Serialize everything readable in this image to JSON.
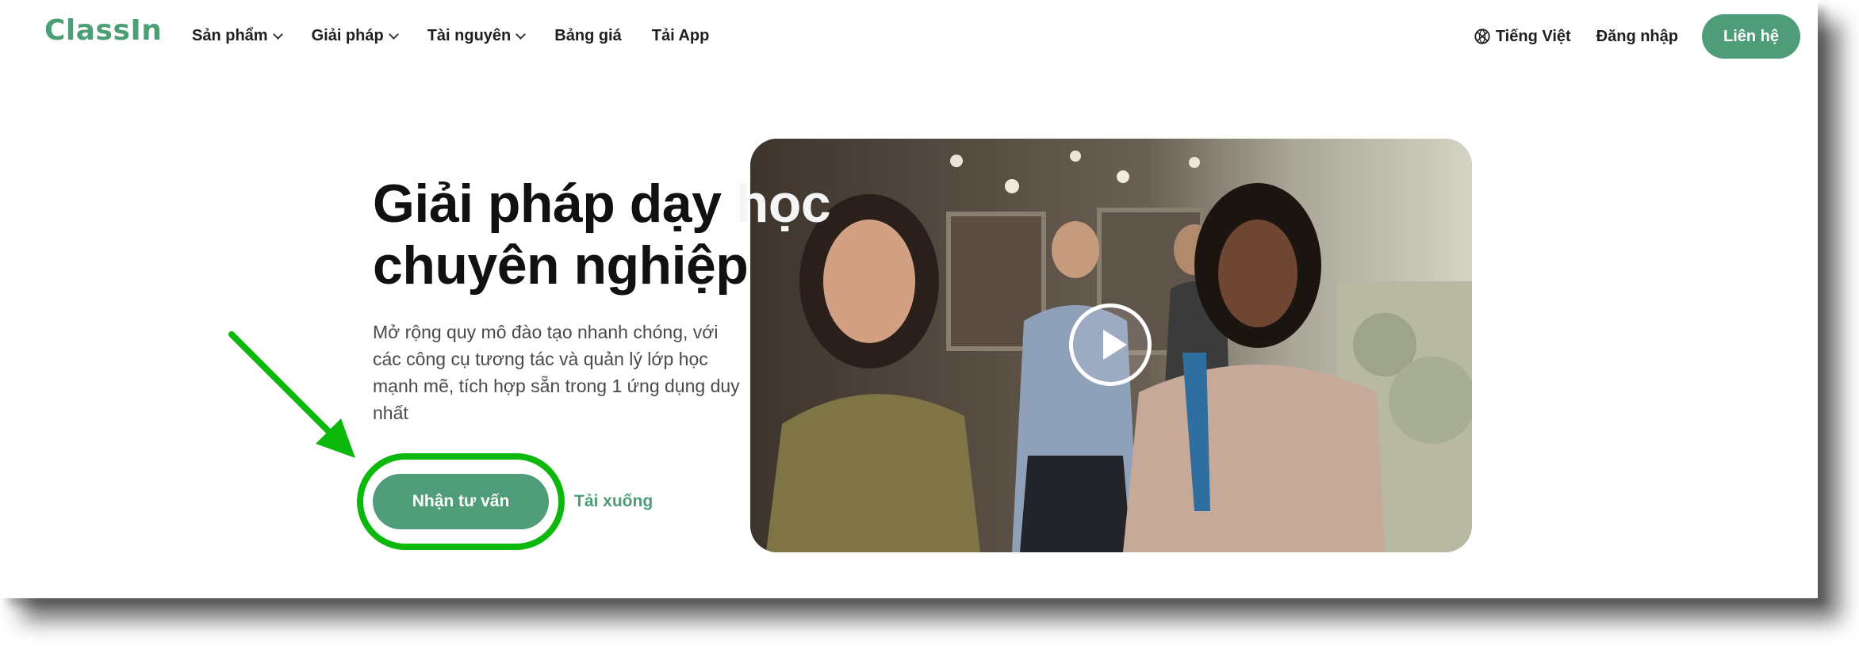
{
  "brand": {
    "logo_text": "ClassIn",
    "accent_color": "#4e9c78"
  },
  "nav": {
    "menu": [
      {
        "label": "Sản phẩm",
        "has_dropdown": true
      },
      {
        "label": "Giải pháp",
        "has_dropdown": true
      },
      {
        "label": "Tài nguyên",
        "has_dropdown": true
      },
      {
        "label": "Bảng giá",
        "has_dropdown": false
      },
      {
        "label": "Tải App",
        "has_dropdown": false
      }
    ],
    "language": {
      "label": "Tiếng Việt",
      "icon": "globe-icon"
    },
    "login_label": "Đăng nhập",
    "contact_label": "Liên hệ"
  },
  "hero": {
    "title_line1_dark": "Giải pháp dạy ",
    "title_line1_light": "học",
    "title_line2": "chuyên nghiệp",
    "subtitle": "Mở rộng quy mô đào tạo nhanh chóng, với các công cụ tương tác và quản lý lớp học mạnh mẽ, tích hợp sẵn trong 1 ứng dụng duy nhất",
    "primary_cta": "Nhận tư vấn",
    "secondary_cta": "Tải xuống",
    "video": {
      "icon": "play-icon"
    }
  },
  "annotation": {
    "color": "#0db80d",
    "target": "primary_cta"
  }
}
